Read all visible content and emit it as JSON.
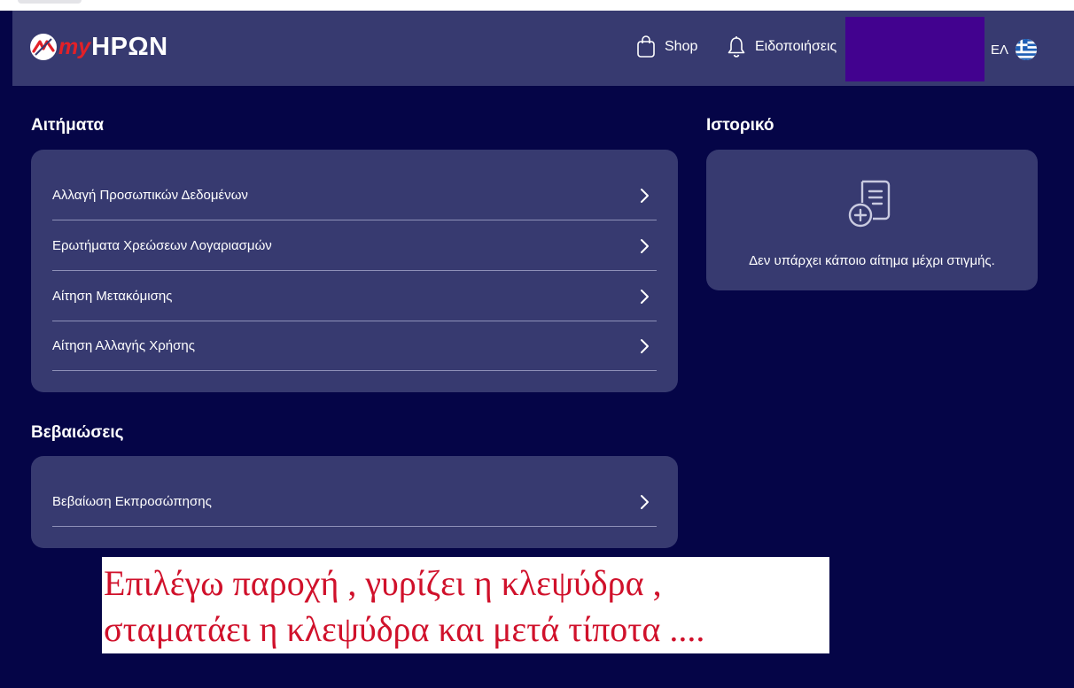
{
  "header": {
    "logo": {
      "prefix": "my",
      "name": "ΗΡΩΝ"
    },
    "nav": {
      "shop": "Shop",
      "notifications": "Ειδοποιήσεις"
    },
    "language": "ΕΛ",
    "icons": {
      "shop": "shopping-bag-icon",
      "notifications": "bell-icon",
      "language_flag": "greek-flag-icon"
    }
  },
  "requests": {
    "title": "Αιτήματα",
    "items": [
      {
        "label": "Αλλαγή Προσωπικών Δεδομένων"
      },
      {
        "label": "Ερωτήματα Χρεώσεων Λογαριασμών"
      },
      {
        "label": "Αίτηση Μετακόμισης"
      },
      {
        "label": "Αίτηση Αλλαγής Χρήσης"
      }
    ]
  },
  "certificates": {
    "title": "Βεβαιώσεις",
    "items": [
      {
        "label": "Βεβαίωση Εκπροσώπησης"
      }
    ]
  },
  "history": {
    "title": "Ιστορικό",
    "empty_text": "Δεν υπάρχει κάποιο αίτημα μέχρι στιγμής.",
    "icon": "document-add-icon"
  },
  "annotation": {
    "line1": "Επιλέγω παροχή , γυρίζει η κλεψύδρα ,",
    "line2": "σταματάει η κλεψύδρα και μετά τίποτα ...."
  },
  "colors": {
    "page_background": "#050547",
    "header_background": "#373a70",
    "card_background": "#373a70",
    "brand_red": "#e32027",
    "redaction": "#42028f",
    "annotation_text": "#d0112b"
  }
}
